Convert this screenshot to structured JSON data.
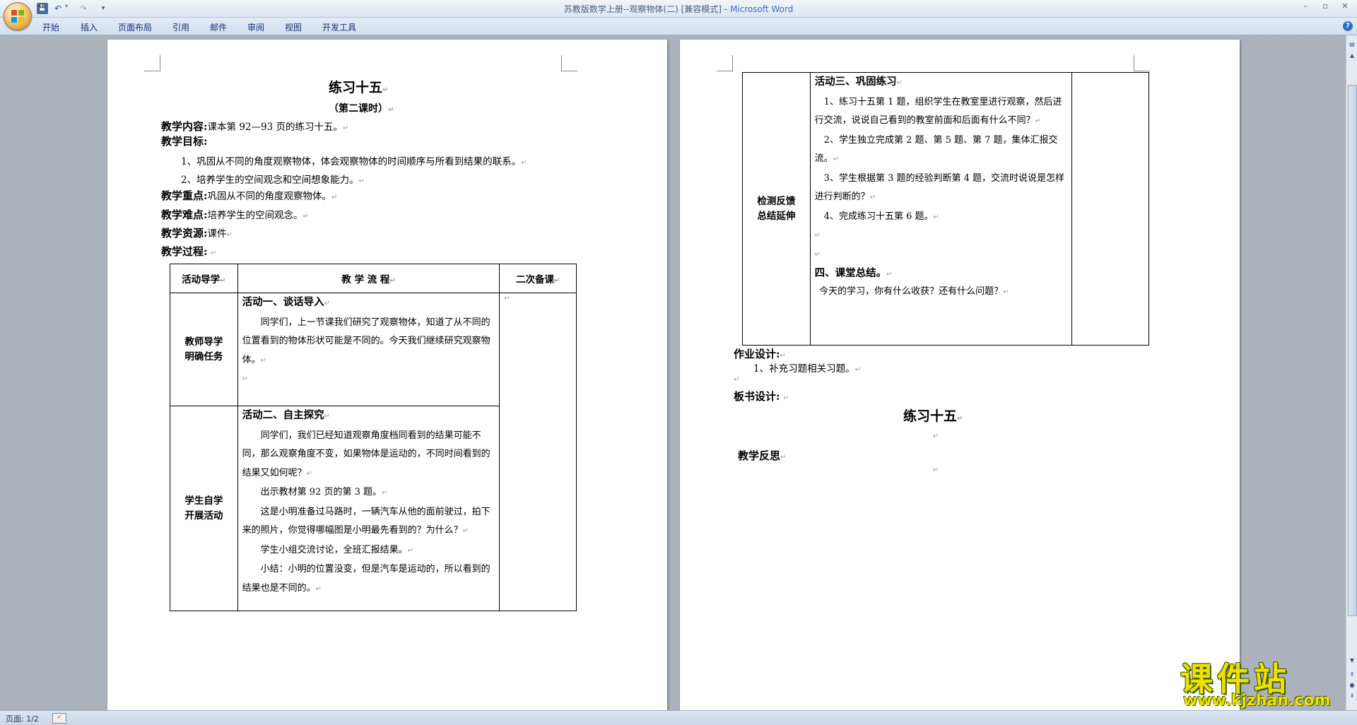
{
  "window": {
    "title": "苏教版数学上册--观察物体(二) [兼容模式] - ",
    "app_name": "Microsoft Word"
  },
  "quick_access": {
    "save": "💾",
    "undo": "↶",
    "redo": "↷",
    "more": "▾"
  },
  "ribbon_tabs": [
    "开始",
    "插入",
    "页面布局",
    "引用",
    "邮件",
    "审阅",
    "视图",
    "开发工具"
  ],
  "status": {
    "page": "页面: 1/2"
  },
  "para_mark": "↵",
  "page1": {
    "title": "练习十五",
    "subtitle": "（第二课时）",
    "content_label": "教学内容:",
    "content_text": "课本第 92—93 页的练习十五。",
    "goal_label": "教学目标:",
    "goal_1": "1、巩固从不同的角度观察物体，体会观察物体的时间顺序与所看到结果的联系。",
    "goal_2": "2、培养学生的空间观念和空间想象能力。",
    "key_label": "教学重点:",
    "key_text": "巩固从不同的角度观察物体。",
    "diff_label": "教学难点:",
    "diff_text": "培养学生的空间观念。",
    "res_label": "教学资源:",
    "res_text": "课件",
    "proc_label": "教学过程:",
    "table": {
      "head_1": "活动导学",
      "head_2": "教  学  流  程",
      "head_3": "二次备课",
      "row1_label_a": "教师导学",
      "row1_label_b": "明确任务",
      "row1_title": "活动一、谈话导入",
      "row1_text": "同学们，上一节课我们研究了观察物体，知道了从不同的位置看到的物体形状可能是不同的。今天我们继续研究观察物体。",
      "row2_label_a": "学生自学",
      "row2_label_b": "开展活动",
      "row2_title": "活动二、自主探究",
      "row2_p1": "同学们，我们已经知道观察角度档同看到的结果可能不同，那么观察角度不变，如果物体是运动的，不同时间看到的结果又如何呢？",
      "row2_p2": "出示教材第 92 页的第 3 题。",
      "row2_p3": "这是小明准备过马路时，一辆汽车从他的面前驶过，拍下来的照片，你觉得哪幅图是小明最先看到的？为什么？",
      "row2_p4": "学生小组交流讨论，全班汇报结果。",
      "row2_p5": "小结：小明的位置没变，但是汽车是运动的，所以看到的结果也是不同的。"
    }
  },
  "page2": {
    "table": {
      "label_a": "检测反馈",
      "label_b": "总结延伸",
      "title_3": "活动三、巩固练习",
      "item_1": "1、练习十五第 1 题，组织学生在教室里进行观察，然后进行交流，说说自己看到的教室前面和后面有什么不同？",
      "item_2": "2、学生独立完成第 2 题、第 5 题、第 7 题，集体汇报交流。",
      "item_3": "3、学生根据第 3 题的经验判断第 4 题，交流时说说是怎样进行判断的？",
      "item_4": "4、完成练习十五第 6 题。",
      "title_4": "四、课堂总结。",
      "summary": "今天的学习，你有什么收获？还有什么问题？"
    },
    "hw_label": "作业设计:",
    "hw_text": "1、补充习题相关习题。",
    "board_label": "板书设计:",
    "board_title": "练习十五",
    "reflect_label": "教学反思"
  },
  "watermark": {
    "text": "课件站",
    "url": "www.kjzhan.com"
  }
}
